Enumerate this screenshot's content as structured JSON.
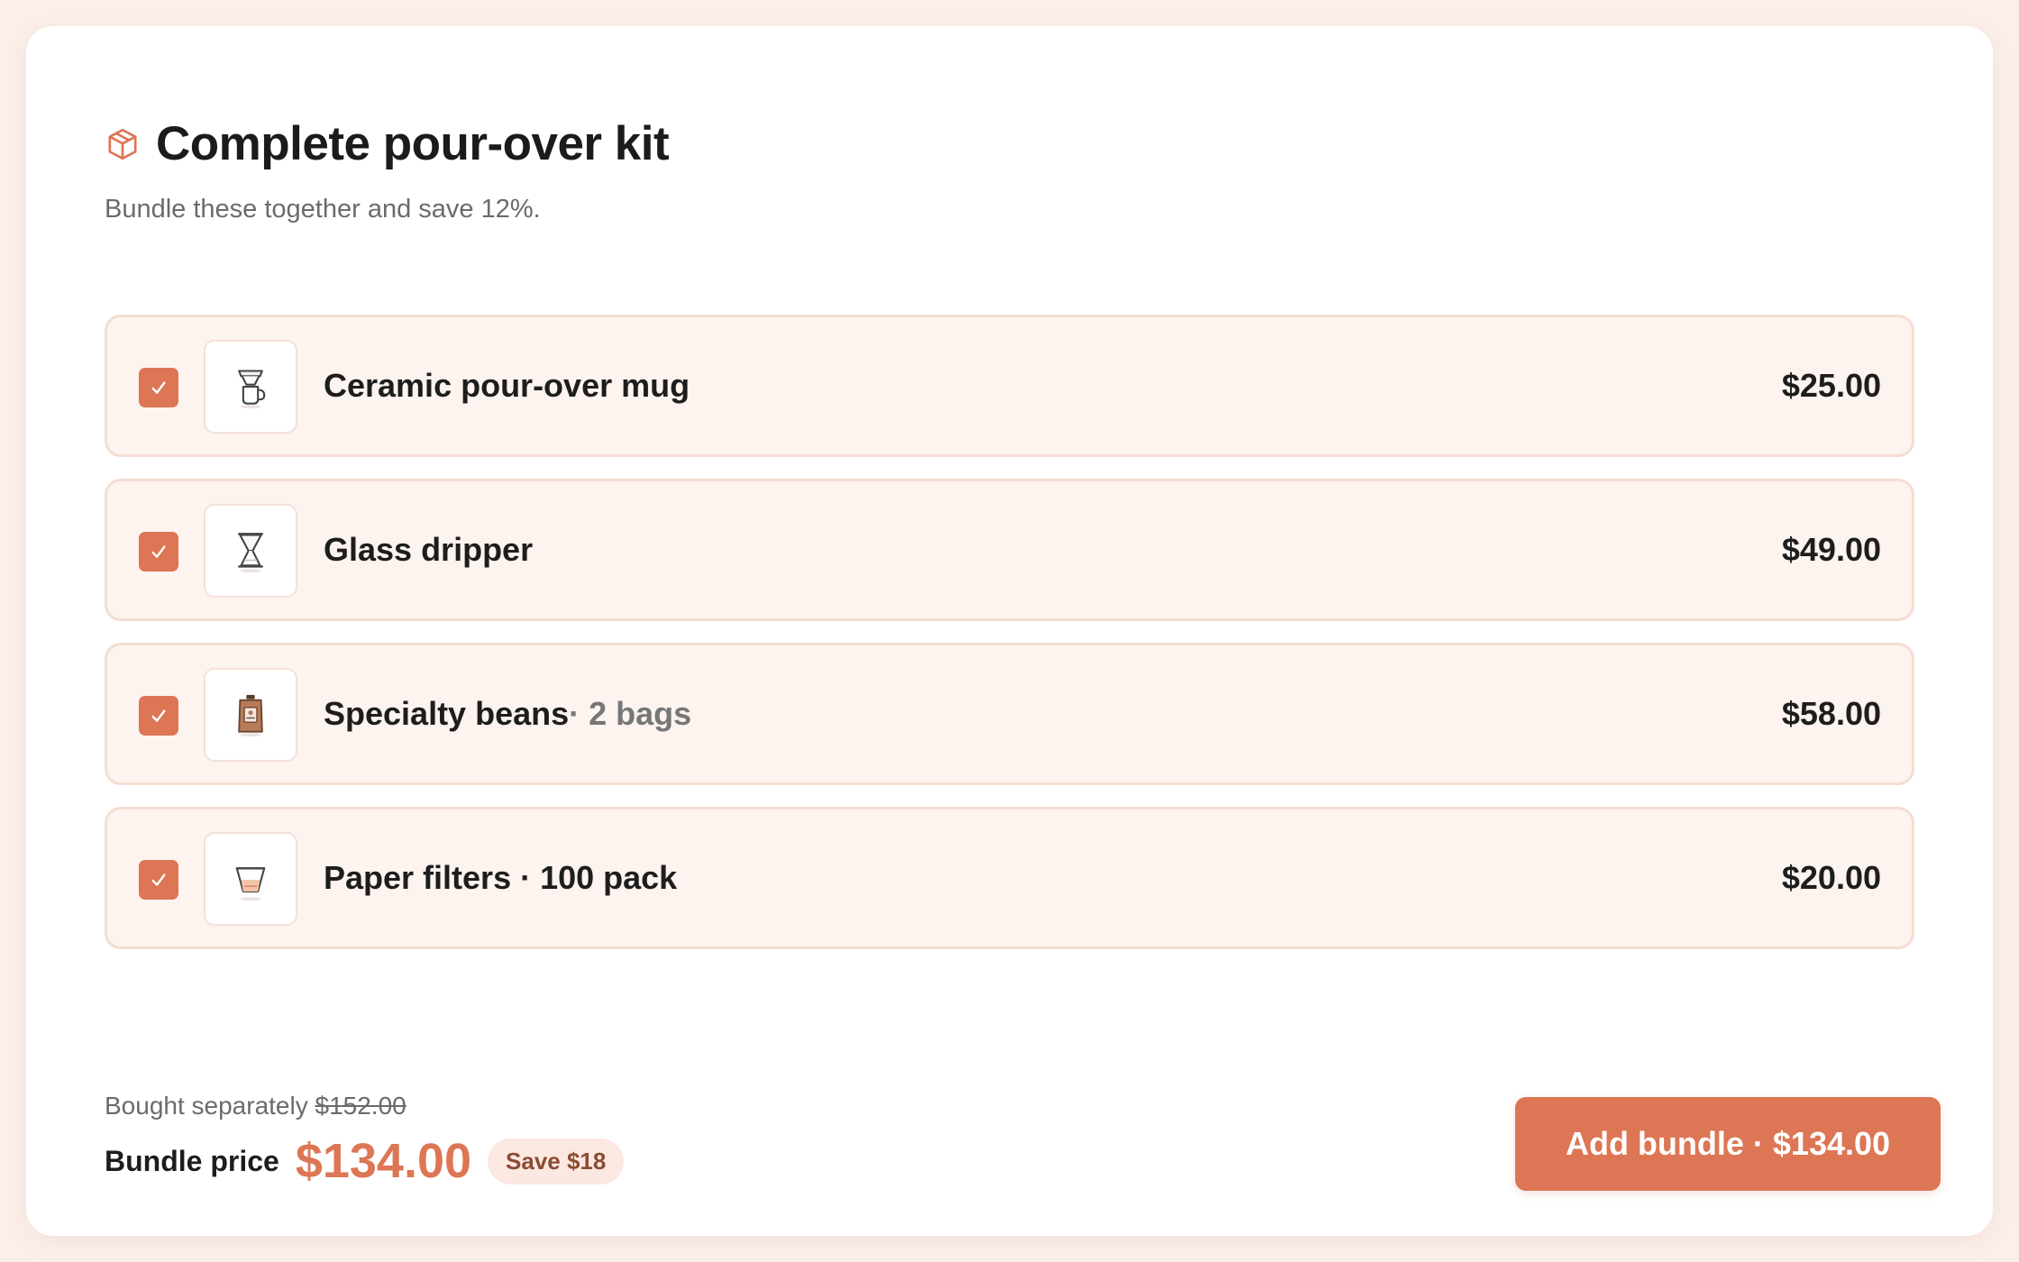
{
  "header": {
    "title": "Complete pour-over kit",
    "subtitle": "Bundle these together and save 12%."
  },
  "items": [
    {
      "name": "Ceramic pour-over mug",
      "sub": "",
      "price": "$25.00",
      "checked": true,
      "icon": "mug-icon"
    },
    {
      "name": "Glass dripper",
      "sub": "",
      "price": "$49.00",
      "checked": true,
      "icon": "dripper-icon"
    },
    {
      "name": "Specialty beans",
      "sub": " · 2 bags",
      "price": "$58.00",
      "checked": true,
      "icon": "coffee-bag-icon"
    },
    {
      "name": "Paper filters · 100 pack",
      "sub": "",
      "price": "$20.00",
      "checked": true,
      "icon": "filter-icon"
    }
  ],
  "summary": {
    "bought_label": "Bought separately ",
    "bought_price": "$152.00",
    "bundle_label": "Bundle price",
    "bundle_price": "$134.00",
    "save_badge": "Save $18"
  },
  "cta": {
    "label": "Add bundle · $134.00"
  },
  "colors": {
    "accent": "#dc7654",
    "row_bg": "#fdf3ef",
    "page_bg": "#fbefea"
  }
}
